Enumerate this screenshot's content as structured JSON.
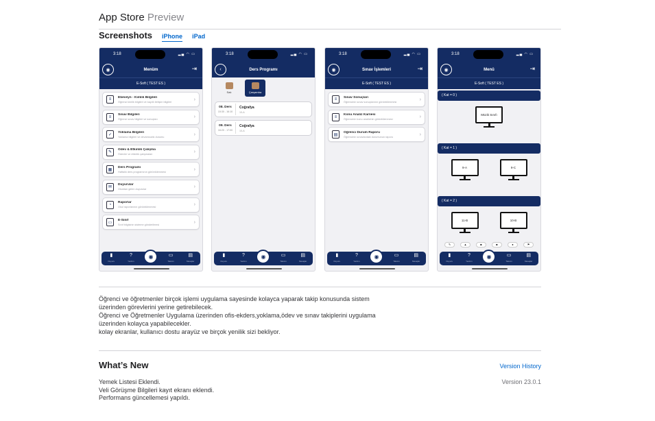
{
  "header": {
    "title": "App Store",
    "title_suffix": "Preview"
  },
  "screenshots": {
    "section_title": "Screenshots",
    "device_tabs": [
      {
        "label": "iPhone",
        "active": true
      },
      {
        "label": "iPad",
        "active": false
      }
    ]
  },
  "phone_common": {
    "status_time": "3:18",
    "tab_labels": [
      "Duyuru",
      "Yardım",
      "",
      "Takvim",
      "Mesajlar"
    ],
    "tab_icons": [
      "▮",
      "?",
      "◉",
      "▭",
      "▤"
    ]
  },
  "screens": [
    {
      "nav_title": "Menüm",
      "sub_bar": "E-Soft ( TEST ES )",
      "items": [
        {
          "title": "Ebeveyn - Kimlik Bilgileri",
          "subtitle": "Öğrenci kimlik bilgileri ve kayıtlı iletişim bilgileri"
        },
        {
          "title": "Sınav Bilgileri",
          "subtitle": "Öğrenci sınav bilgileri ve sonuçları"
        },
        {
          "title": "Yoklama Bilgileri",
          "subtitle": "Yoklama bilgileri ve devamsızlık durumu"
        },
        {
          "title": "Ödev & Etkinlik Çalışma",
          "subtitle": "Ödevler ve etkinlik çalışmaları"
        },
        {
          "title": "Ders Programı",
          "subtitle": "Haftalık ders programının görüntülenmesi"
        },
        {
          "title": "Duyurular",
          "subtitle": "Okuldan gelen duyurular"
        },
        {
          "title": "Raporlar",
          "subtitle": "Okul raporlarının görüntülenmesi"
        },
        {
          "title": "E-Sınıf",
          "subtitle": "Sınıf bilgisinin sisteme gönderilmesi"
        }
      ]
    },
    {
      "nav_title": "Ders Programı",
      "segments": [
        "Salı",
        "Çarşamba"
      ],
      "lessons": [
        {
          "no": "08. Ders",
          "time": "15:30 - 16:10",
          "name": "Coğrafya",
          "teacher": "10-A"
        },
        {
          "no": "09. Ders",
          "time": "16:20 - 17:00",
          "name": "Coğrafya",
          "teacher": "10-A"
        }
      ]
    },
    {
      "nav_title": "Sınav İşlemleri",
      "sub_bar": "E-Soft ( TEST ES )",
      "items": [
        {
          "title": "Sınav Sonuçları",
          "subtitle": "Öğrencinin sınav sonuçlarının görüntülenmesi"
        },
        {
          "title": "Konu Analiz Karnesi",
          "subtitle": "Öğrencinin konu analizinin görüntülenmesi"
        },
        {
          "title": "Öğrenci Durum Raporu",
          "subtitle": "Öğrencinin sınavlardaki durumunun raporu"
        }
      ]
    },
    {
      "nav_title": "Menü",
      "sub_bar": "E-Soft ( TEST ES )",
      "floors": [
        {
          "label": "( Kat = 0 )",
          "rooms": [
            "Müzik Sınıfı"
          ]
        },
        {
          "label": "( Kat = 1 )",
          "rooms": [
            "9-A",
            "9-C"
          ]
        },
        {
          "label": "( Kat = 2 )",
          "rooms": [
            "11-B",
            "10-B"
          ]
        }
      ],
      "pills": [
        "✎",
        "▲",
        "■",
        "■",
        "●",
        "⚑"
      ]
    }
  ],
  "description": {
    "lines": [
      "Öğrenci ve öğretmenler birçok işlemi uygulama sayesinde kolayca yaparak takip konusunda sistem",
      "üzerinden görevlerini yerine getirebilecek.",
      "Öğrenci ve Öğretmenler Uygulama üzerinden ofis-ekders,yoklama,ödev ve sınav takiplerini uygulama",
      "üzerinden kolayca yapabilecekler.",
      "kolay ekranlar, kullanıcı dostu arayüz ve birçok yenilik sizi bekliyor."
    ]
  },
  "whats_new": {
    "title": "What’s New",
    "version_history_label": "Version History",
    "version": "Version 23.0.1",
    "notes": [
      "Yemek Listesi Eklendi.",
      "Veli Görüşme Bilgileri kayıt ekranı eklendi.",
      "Performans güncellemesi yapıldı."
    ]
  }
}
